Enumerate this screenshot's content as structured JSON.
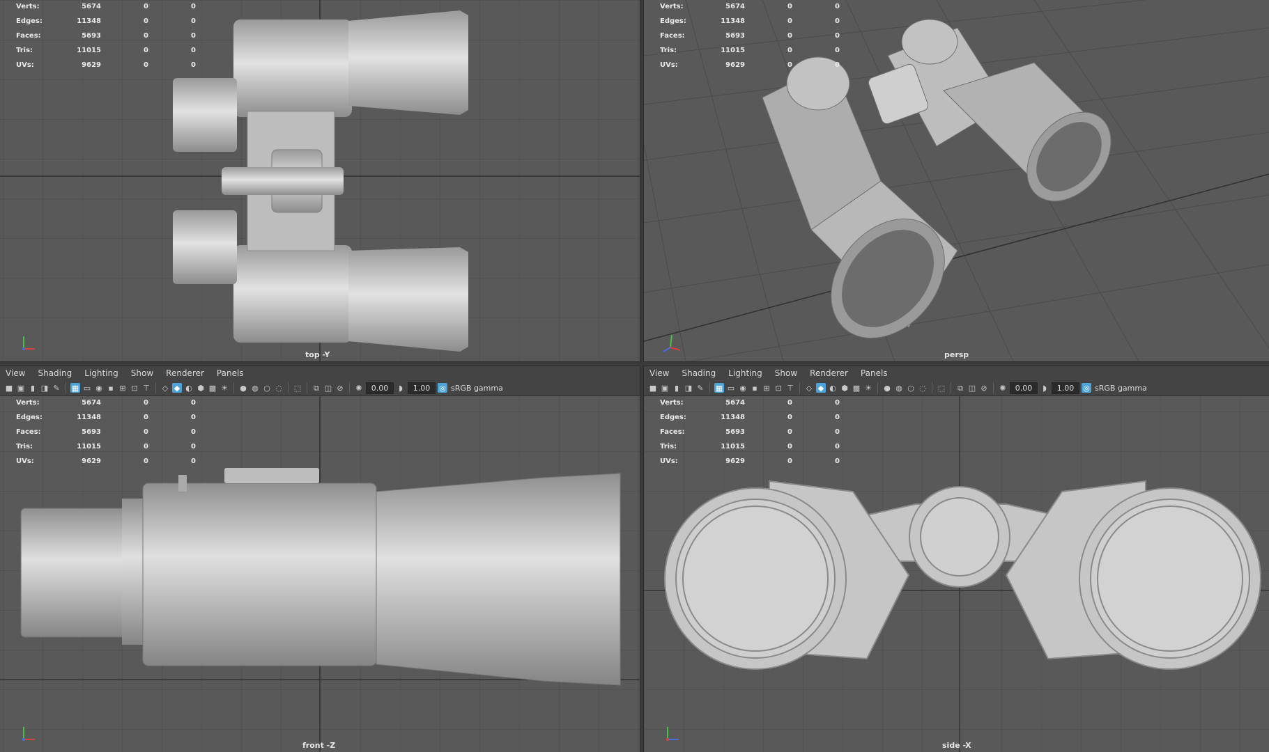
{
  "menu": [
    "View",
    "Shading",
    "Lighting",
    "Show",
    "Renderer",
    "Panels"
  ],
  "toolbar": {
    "exposure": "0.00",
    "gamma": "1.00",
    "colorspace": "sRGB gamma"
  },
  "hud": {
    "rows": [
      {
        "label": "Verts:",
        "value": "5674",
        "a": "0",
        "b": "0"
      },
      {
        "label": "Edges:",
        "value": "11348",
        "a": "0",
        "b": "0"
      },
      {
        "label": "Faces:",
        "value": "5693",
        "a": "0",
        "b": "0"
      },
      {
        "label": "Tris:",
        "value": "11015",
        "a": "0",
        "b": "0"
      },
      {
        "label": "UVs:",
        "value": "9629",
        "a": "0",
        "b": "0"
      }
    ]
  },
  "viewports": {
    "top": {
      "label": "top -Y"
    },
    "persp": {
      "label": "persp"
    },
    "front": {
      "label": "front -Z"
    },
    "side": {
      "label": "side -X"
    }
  },
  "colors": {
    "viewport_bg": "#595959",
    "grid": "#4a4a4a",
    "grid_axis": "#2e2e2e",
    "model": "#c9c9c9",
    "accent": "#4aa3d9"
  },
  "icons": [
    "camera-icon",
    "grid-icon",
    "wireframe-icon",
    "smooth-shade-icon",
    "light-icon",
    "isolate-icon",
    "exposure-icon",
    "gamma-icon",
    "colorspace-icon"
  ]
}
